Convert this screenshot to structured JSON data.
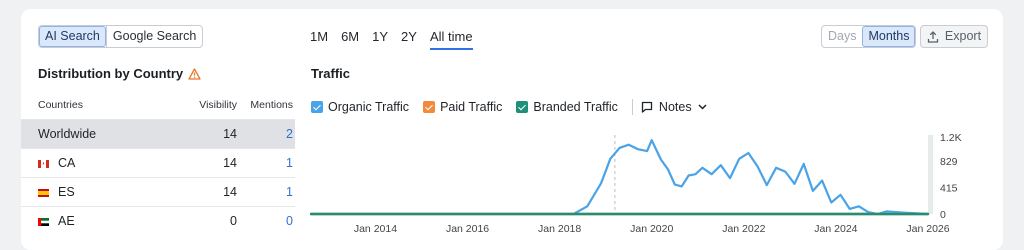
{
  "search_toggle": {
    "ai_label": "AI Search",
    "google_label": "Google Search",
    "selected": "AI Search"
  },
  "ranges": [
    {
      "label": "1M",
      "active": false
    },
    {
      "label": "6M",
      "active": false
    },
    {
      "label": "1Y",
      "active": false
    },
    {
      "label": "2Y",
      "active": false
    },
    {
      "label": "All time",
      "active": true
    }
  ],
  "granularity": {
    "days_label": "Days",
    "months_label": "Months",
    "selected": "Months"
  },
  "export_label": "Export",
  "distribution": {
    "title": "Distribution by Country",
    "columns": {
      "country": "Countries",
      "visibility": "Visibility",
      "mentions": "Mentions"
    },
    "rows": [
      {
        "country": "Worldwide",
        "flag": "",
        "visibility": "14",
        "mentions": "2",
        "selected": true
      },
      {
        "country": "CA",
        "flag": "canada-flag-icon",
        "visibility": "14",
        "mentions": "1",
        "selected": false
      },
      {
        "country": "ES",
        "flag": "spain-flag-icon",
        "visibility": "14",
        "mentions": "1",
        "selected": false
      },
      {
        "country": "AE",
        "flag": "uae-flag-icon",
        "visibility": "0",
        "mentions": "0",
        "selected": false
      }
    ]
  },
  "traffic": {
    "title": "Traffic",
    "legend": [
      {
        "label": "Organic Traffic",
        "color": "#4aa3e8",
        "checked": true
      },
      {
        "label": "Paid Traffic",
        "color": "#f08a3c",
        "checked": true
      },
      {
        "label": "Branded Traffic",
        "color": "#1e8f78",
        "checked": true
      }
    ],
    "notes_label": "Notes"
  },
  "chart_data": {
    "type": "line",
    "title": "",
    "xlabel": "",
    "ylabel": "",
    "x_ticks": [
      "Jan 2014",
      "Jan 2016",
      "Jan 2018",
      "Jan 2020",
      "Jan 2022",
      "Jan 2024",
      "Jan 2026"
    ],
    "y_ticks": [
      "0",
      "415",
      "829",
      "1.2K"
    ],
    "xlim": [
      2012.6,
      2026.0
    ],
    "ylim": [
      0,
      1200
    ],
    "grid": false,
    "series": [
      {
        "name": "Organic Traffic",
        "color": "#4aa3e8",
        "x": [
          2012.6,
          2018.3,
          2018.6,
          2018.9,
          2019.1,
          2019.3,
          2019.5,
          2019.7,
          2019.9,
          2020.0,
          2020.2,
          2020.35,
          2020.5,
          2020.65,
          2020.8,
          2020.95,
          2021.1,
          2021.3,
          2021.5,
          2021.7,
          2021.9,
          2022.1,
          2022.3,
          2022.5,
          2022.7,
          2022.9,
          2023.1,
          2023.3,
          2023.5,
          2023.7,
          2023.9,
          2024.1,
          2024.3,
          2024.5,
          2024.7,
          2024.9,
          2025.1,
          2025.5,
          2026.0
        ],
        "y": [
          0,
          0,
          120,
          480,
          860,
          1030,
          1080,
          1010,
          980,
          1150,
          850,
          700,
          460,
          430,
          600,
          620,
          720,
          620,
          760,
          560,
          860,
          950,
          740,
          450,
          720,
          660,
          470,
          780,
          360,
          520,
          180,
          300,
          80,
          120,
          30,
          0,
          40,
          20,
          0
        ]
      },
      {
        "name": "Paid Traffic",
        "color": "#f08a3c",
        "x": [
          2012.6,
          2026.0
        ],
        "y": [
          0,
          0
        ]
      },
      {
        "name": "Branded Traffic",
        "color": "#1e8f78",
        "x": [
          2012.6,
          2026.0
        ],
        "y": [
          0,
          0
        ]
      }
    ],
    "note_marker_x": 2019.2
  }
}
